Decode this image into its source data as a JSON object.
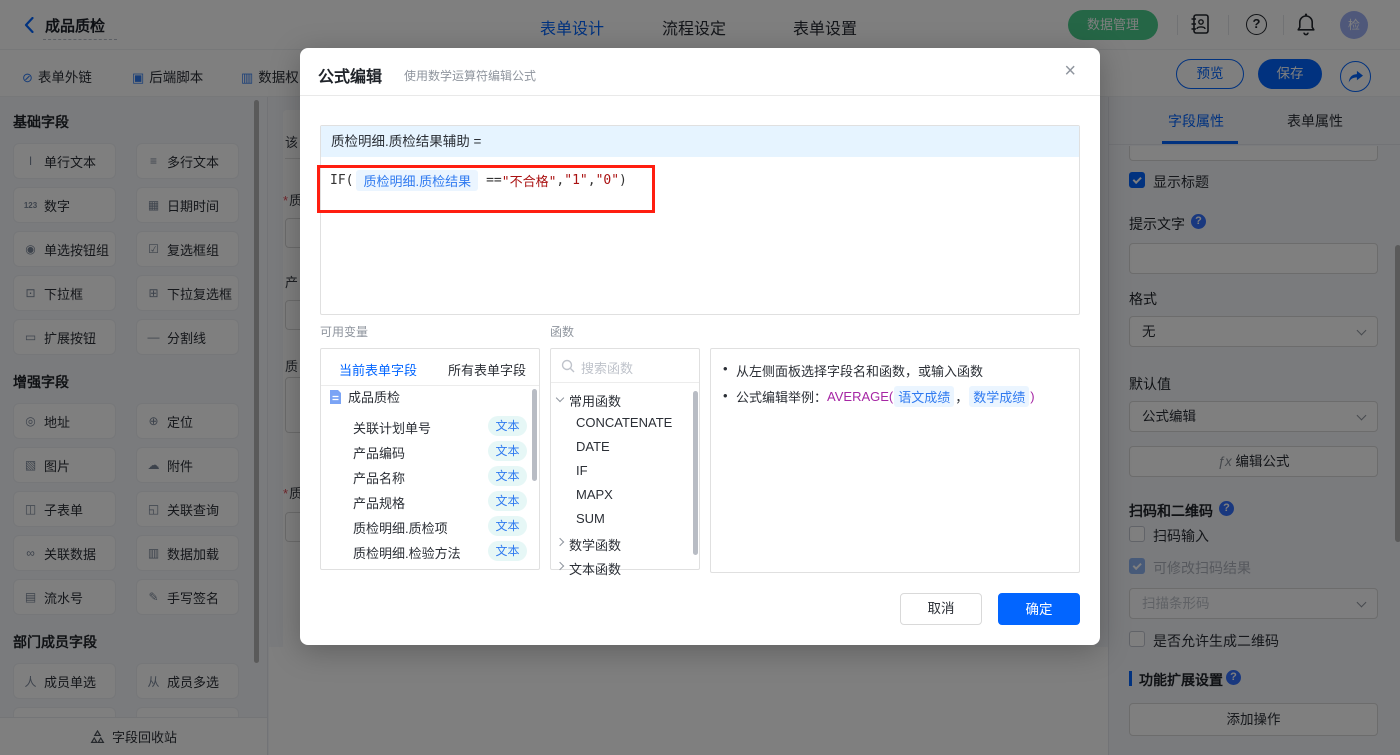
{
  "colors": {
    "accent_blue": "#0265ff",
    "green": "#4acc8c",
    "annotation_red": "#ff1e10",
    "string_red": "#aa1111",
    "chip_bg": "#ebf5ff",
    "type_chip_bg": "#e6f7f6"
  },
  "icons": {
    "single_line_text": "I",
    "multi_line_text": "≡",
    "number": "123",
    "datetime": "▦",
    "radio_group": "◉",
    "checkbox_group": "☑",
    "dropdown": "⊡",
    "dropdown_multi": "⊞",
    "extend_button": "▭",
    "divider": "—",
    "address": "◎",
    "location": "⊕",
    "image": "▧",
    "attachment": "☁",
    "subform": "◫",
    "linked_query": "◱",
    "linked_data": "∞",
    "data_load": "▥",
    "serial_number": "▤",
    "signature": "✎",
    "member_single": "人",
    "member_multi": "从",
    "link": "⊘",
    "script": "▣",
    "perm": "▥"
  },
  "header": {
    "title": "成品质检",
    "tabs": [
      {
        "label": "表单设计"
      },
      {
        "label": "流程设定"
      },
      {
        "label": "表单设置"
      }
    ],
    "data_manage_button": "数据管理",
    "avatar_text": "检"
  },
  "toolbar": {
    "links": [
      {
        "label": "表单外链"
      },
      {
        "label": "后端脚本"
      },
      {
        "label": "数据权"
      }
    ],
    "preview_button": "预览",
    "save_button": "保存"
  },
  "sidebar": {
    "sections": [
      {
        "title": "基础字段",
        "items": [
          {
            "label": "单行文本"
          },
          {
            "label": "多行文本"
          },
          {
            "label": "数字"
          },
          {
            "label": "日期时间"
          },
          {
            "label": "单选按钮组"
          },
          {
            "label": "复选框组"
          },
          {
            "label": "下拉框"
          },
          {
            "label": "下拉复选框"
          },
          {
            "label": "扩展按钮"
          },
          {
            "label": "分割线"
          }
        ]
      },
      {
        "title": "增强字段",
        "items": [
          {
            "label": "地址"
          },
          {
            "label": "定位"
          },
          {
            "label": "图片"
          },
          {
            "label": "附件"
          },
          {
            "label": "子表单"
          },
          {
            "label": "关联查询"
          },
          {
            "label": "关联数据"
          },
          {
            "label": "数据加载"
          },
          {
            "label": "流水号"
          },
          {
            "label": "手写签名"
          }
        ]
      },
      {
        "title": "部门成员字段",
        "items": [
          {
            "label": "成员单选"
          },
          {
            "label": "成员多选"
          }
        ]
      }
    ],
    "recycle_label": "字段回收站"
  },
  "canvas": {
    "labels": [
      {
        "text": "该"
      },
      {
        "text": "质",
        "required": "*"
      },
      {
        "text": "产"
      },
      {
        "text": "质"
      },
      {
        "text": "质",
        "required": "*"
      }
    ]
  },
  "modal": {
    "title": "公式编辑",
    "subtitle": "使用数学运算符编辑公式",
    "close": "×",
    "assign_target": "质检明细.质检结果辅助 =",
    "formula": {
      "fn_open": "IF(",
      "field_chip": "质检明细.质检结果",
      "operator": "==",
      "string1": "\"不合格\"",
      "comma1": ",",
      "string2": "\"1\"",
      "comma2": ",",
      "string3": "\"0\"",
      "close": ")"
    },
    "variables": {
      "label": "可用变量",
      "tab_current": "当前表单字段",
      "tab_all": "所有表单字段",
      "root": "成品质检",
      "fields": [
        {
          "name": "关联计划单号",
          "type": "文本"
        },
        {
          "name": "产品编码",
          "type": "文本"
        },
        {
          "name": "产品名称",
          "type": "文本"
        },
        {
          "name": "产品规格",
          "type": "文本"
        },
        {
          "name": "质检明细.质检项",
          "type": "文本"
        },
        {
          "name": "质检明细.检验方法",
          "type": "文本"
        }
      ]
    },
    "functions": {
      "label": "函数",
      "search_placeholder": "搜索函数",
      "group_common": "常用函数",
      "common_items": [
        "CONCATENATE",
        "DATE",
        "IF",
        "MAPX",
        "SUM"
      ],
      "group_math": "数学函数",
      "group_text": "文本函数"
    },
    "help": {
      "tip1": "从左侧面板选择字段名和函数，或输入函数",
      "tip2_prefix": "公式编辑举例：",
      "tip2_fn": "AVERAGE(",
      "tip2_chip1": "语文成绩",
      "tip2_comma": "，",
      "tip2_chip2": "数学成绩",
      "tip2_close": ")"
    },
    "cancel_button": "取消",
    "confirm_button": "确定"
  },
  "properties": {
    "tab_field": "字段属性",
    "tab_form": "表单属性",
    "show_title": "显示标题",
    "hint_label": "提示文字",
    "format_label": "格式",
    "format_value": "无",
    "default_label": "默认值",
    "default_value": "公式编辑",
    "fx_prefix": "ƒx",
    "edit_formula_button": "编辑公式",
    "scan_section": "扫码和二维码",
    "scan_input": "扫码输入",
    "scan_modify": "可修改扫码结果",
    "scan_type_value": "扫描条形码",
    "qr_allow": "是否允许生成二维码",
    "extension_section": "功能扩展设置",
    "add_action_button": "添加操作"
  }
}
